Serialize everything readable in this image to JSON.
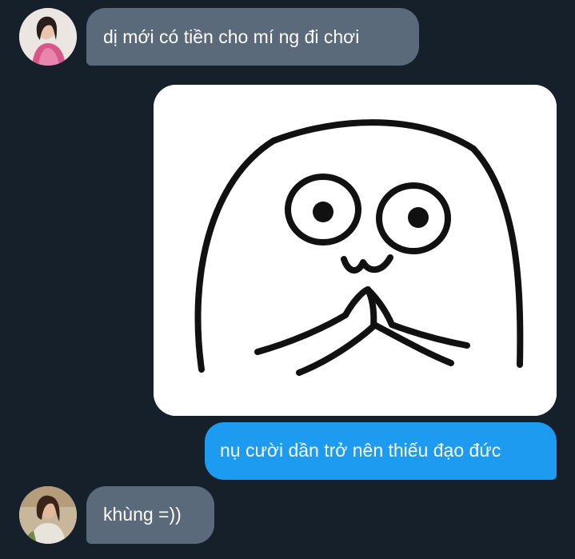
{
  "conversation": {
    "messages": [
      {
        "direction": "incoming",
        "type": "text",
        "text": "dị mới có tiền cho mí ng đi chơi"
      },
      {
        "direction": "outgoing",
        "type": "image",
        "icon": "pleading-face-doodle-sticker"
      },
      {
        "direction": "outgoing",
        "type": "text",
        "text": "nụ cười dần trở nên thiếu đạo đức"
      },
      {
        "direction": "incoming",
        "type": "text",
        "text": "khùng =))"
      }
    ]
  },
  "colors": {
    "background": "#15202b",
    "incoming_bubble": "#5a6a7b",
    "outgoing_bubble": "#1d9bf0",
    "text": "#ffffff"
  }
}
